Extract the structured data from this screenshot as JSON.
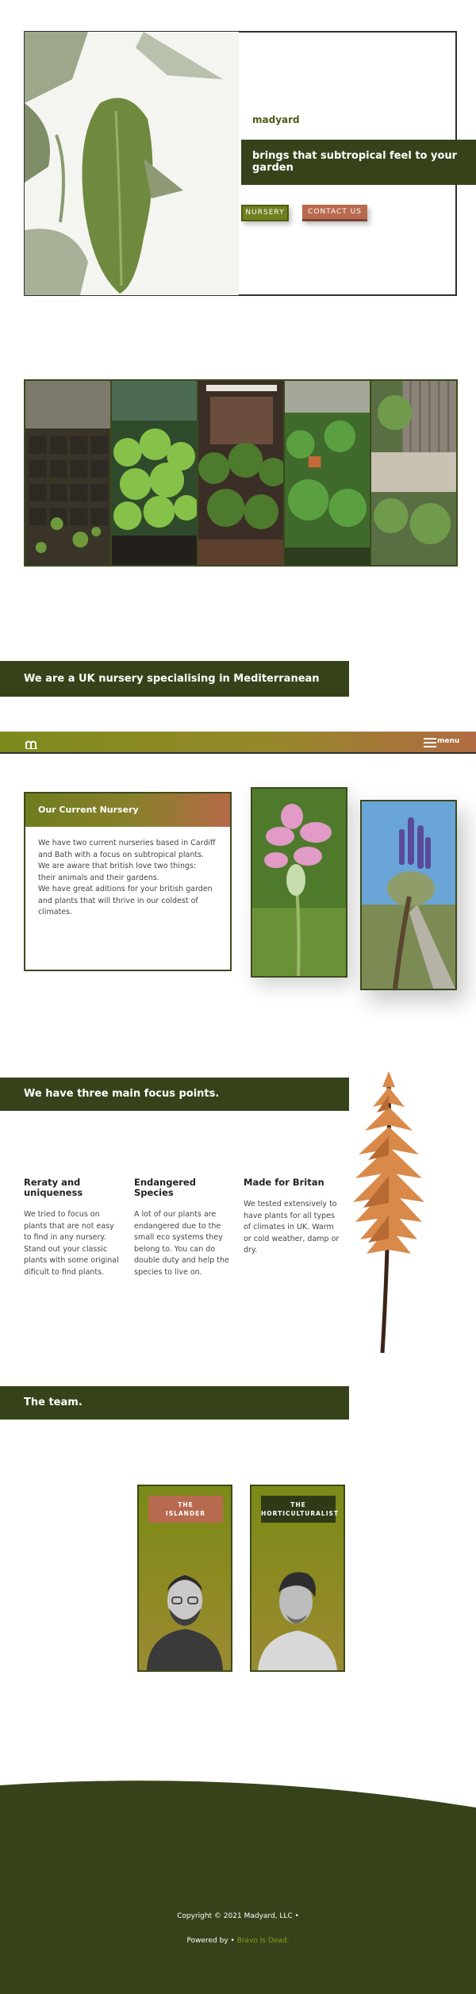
{
  "hero": {
    "brand": "madyard",
    "tagline": "brings that subtropical feel to your garden",
    "nursery_button": "NURSERY",
    "contact_button": "CONTACT US"
  },
  "about": {
    "headline": "We are a  UK nursery specialising in Mediterranean plants."
  },
  "nav": {
    "logo": "m",
    "menu_label": "menu"
  },
  "nursery": {
    "title": "Our Current Nursery",
    "paragraph1": "We have two current nurseries based in Cardiff and Bath with a focus on subtropical plants.",
    "paragraph2": "We are aware that british love two things: their animals and their gardens.",
    "paragraph3": "We have great aditions for your british garden and plants that will thrive in our coldest of climates."
  },
  "focus": {
    "headline": "We have three main focus points.",
    "points": [
      {
        "title": "Reraty and uniqueness",
        "text1": "We tried to focus on plants that are not easy to find in any nursery.",
        "text2": "Stand out  your classic plants with some original dificult to find plants."
      },
      {
        "title": "Endangered Species",
        "text1": "A lot of our plants are endangered due to the small eco systems they belong to.  You can do double duty and help the species to live on.",
        "text2": ""
      },
      {
        "title": "Made for Britan",
        "text1": "We tested extensively to have plants for all types of climates in UK. Warm or cold weather, damp or dry.",
        "text2": ""
      }
    ]
  },
  "team": {
    "headline": "The team.",
    "members": [
      {
        "role_line1": "THE",
        "role_line2": "ISLANDER"
      },
      {
        "role_line1": "THE",
        "role_line2": "HORTICULTURALIST"
      }
    ]
  },
  "footer": {
    "copyright": "Copyright © 2021 Madyard, LLC •",
    "powered_prefix": "Powered by  •",
    "powered_link": "Bravo Is Dead."
  },
  "colors": {
    "dark_green": "#36431a",
    "olive": "#7a8a18",
    "terracotta": "#b86a4f"
  }
}
